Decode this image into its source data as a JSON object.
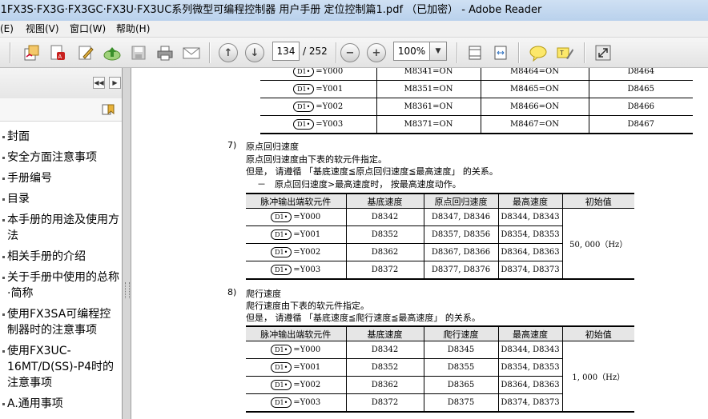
{
  "window": {
    "title": "i1FX3S·FX3G·FX3GC·FX3U·FX3UC系列微型可编程控制器 用户手册 定位控制篇1.pdf （已加密） - Adobe Reader"
  },
  "menu": [
    "(E)",
    "视图(V)",
    "窗口(W)",
    "帮助(H)"
  ],
  "toolbar": {
    "icons": [
      "open-icon",
      "create-pdf-icon",
      "edit-icon",
      "upload-icon",
      "save-icon",
      "print-icon",
      "email-icon",
      "prev-page-icon",
      "next-page-icon",
      "zoom-out-icon",
      "zoom-in-icon",
      "fit-page-icon",
      "fit-width-icon",
      "comment-icon",
      "highlight-icon",
      "fullscreen-icon"
    ],
    "page_current": "134",
    "page_total": "/ 252",
    "zoom": "100%"
  },
  "sidebar": {
    "bookmarks": [
      "封面",
      "安全方面注意事项",
      "手册编号",
      "目录",
      "本手册的用途及使用方法",
      "相关手册的介绍",
      "关于手册中使用的总称·简称",
      "使用FX3SA可编程控制器时的注意事项",
      "使用FX3UC-16MT/D(SS)-P4时的注意事项",
      "A.通用事项"
    ]
  },
  "document": {
    "d1_label": "D1•",
    "top_table": {
      "rows": [
        [
          "=Y000",
          "M8341=ON",
          "M8464=ON",
          "D8464"
        ],
        [
          "=Y001",
          "M8351=ON",
          "M8465=ON",
          "D8465"
        ],
        [
          "=Y002",
          "M8361=ON",
          "M8466=ON",
          "D8466"
        ],
        [
          "=Y003",
          "M8371=ON",
          "M8467=ON",
          "D8467"
        ]
      ]
    },
    "section7": {
      "number": "7)",
      "title": "原点回归速度",
      "line1": "原点回归速度由下表的软元件指定。",
      "line2": "但是， 请遵循 「基底速度≦原点回归速度≦最高速度」 的关系。",
      "line3": "－　原点回归速度>最高速度时， 按最高速度动作。",
      "headers": [
        "脉冲输出端软元件",
        "基底速度",
        "原点回归速度",
        "最高速度",
        "初始值"
      ],
      "rows": [
        [
          "=Y000",
          "D8342",
          "D8347, D8346",
          "D8344, D8343"
        ],
        [
          "=Y001",
          "D8352",
          "D8357, D8356",
          "D8354, D8353"
        ],
        [
          "=Y002",
          "D8362",
          "D8367, D8366",
          "D8364, D8363"
        ],
        [
          "=Y003",
          "D8372",
          "D8377, D8376",
          "D8374, D8373"
        ]
      ],
      "initial": "50, 000（Hz）"
    },
    "section8": {
      "number": "8)",
      "title": "爬行速度",
      "line1": "爬行速度由下表的软元件指定。",
      "line2": "但是， 请遵循 「基底速度≦爬行速度≦最高速度」 的关系。",
      "headers": [
        "脉冲输出端软元件",
        "基底速度",
        "爬行速度",
        "最高速度",
        "初始值"
      ],
      "rows": [
        [
          "=Y000",
          "D8342",
          "D8345",
          "D8344, D8343"
        ],
        [
          "=Y001",
          "D8352",
          "D8355",
          "D8354, D8353"
        ],
        [
          "=Y002",
          "D8362",
          "D8365",
          "D8364, D8363"
        ],
        [
          "=Y003",
          "D8372",
          "D8375",
          "D8374, D8373"
        ]
      ],
      "initial": "1, 000（Hz）"
    }
  }
}
